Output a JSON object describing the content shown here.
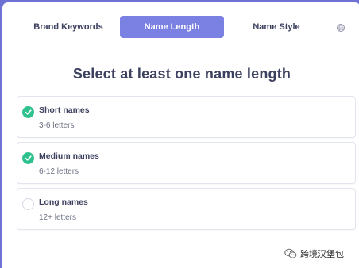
{
  "tabs": [
    {
      "label": "Brand Keywords",
      "active": false
    },
    {
      "label": "Name Length",
      "active": true
    },
    {
      "label": "Name Style",
      "active": false
    }
  ],
  "colors": {
    "accent": "#7b80e3",
    "border": "#6f72d4",
    "check": "#2fc28e",
    "text": "#3d4160"
  },
  "icons": {
    "language": "globe-icon",
    "selected": "check-circle-icon",
    "unselected": "empty-circle-icon",
    "watermark": "wechat-icon"
  },
  "heading": "Select at least one name length",
  "options": [
    {
      "title": "Short names",
      "subtitle": "3-6 letters",
      "checked": true
    },
    {
      "title": "Medium names",
      "subtitle": "6-12 letters",
      "checked": true
    },
    {
      "title": "Long names",
      "subtitle": "12+ letters",
      "checked": false
    }
  ],
  "watermark": {
    "text": "跨境汉堡包"
  }
}
